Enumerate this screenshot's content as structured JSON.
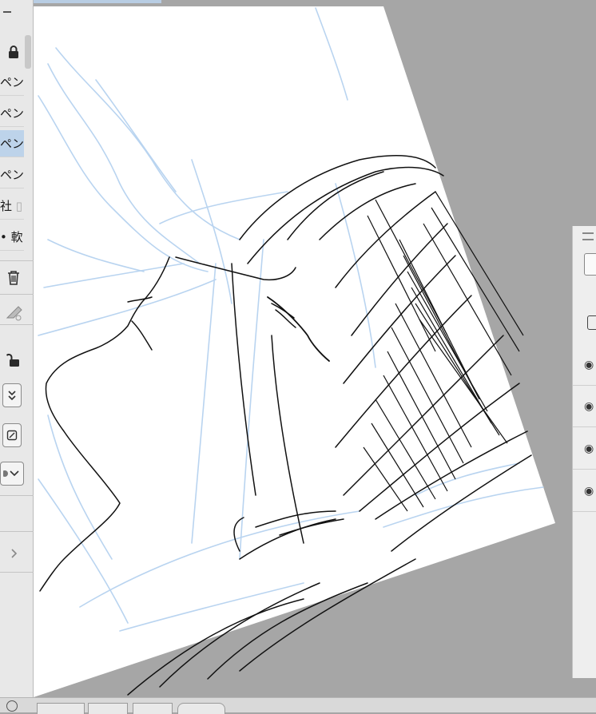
{
  "left_panel": {
    "brush_items": [
      {
        "label": "ペン",
        "selected": false
      },
      {
        "label": "ペン",
        "selected": false
      },
      {
        "label": "ペン",
        "selected": true
      },
      {
        "label": "ペン",
        "selected": false
      },
      {
        "label": "社",
        "selected": false
      },
      {
        "label": "• 軟",
        "selected": false
      }
    ],
    "icons": [
      "lock-icon",
      "trash-icon",
      "eraser-icon",
      "unlock-icon",
      "double-chevron-down-icon",
      "no-entry-icon",
      "chevron-down-icon",
      "chevron-right-icon"
    ]
  },
  "top_strip": {
    "active_tab_color": "#b8cde3"
  },
  "right_panel": {
    "rows": [
      {
        "icon": "eye-icon",
        "visible": true
      },
      {
        "icon": "eye-icon",
        "visible": true
      },
      {
        "icon": "eye-icon",
        "visible": true
      },
      {
        "icon": "eye-icon",
        "visible": true
      }
    ]
  },
  "canvas": {
    "paper_color": "#ffffff",
    "background_color": "#a6a6a6",
    "sketch_color": "#b9d4f0",
    "ink_color": "#111111"
  },
  "colors": {
    "selection": "#bdd3ea",
    "panel": "#e8e8e8"
  }
}
